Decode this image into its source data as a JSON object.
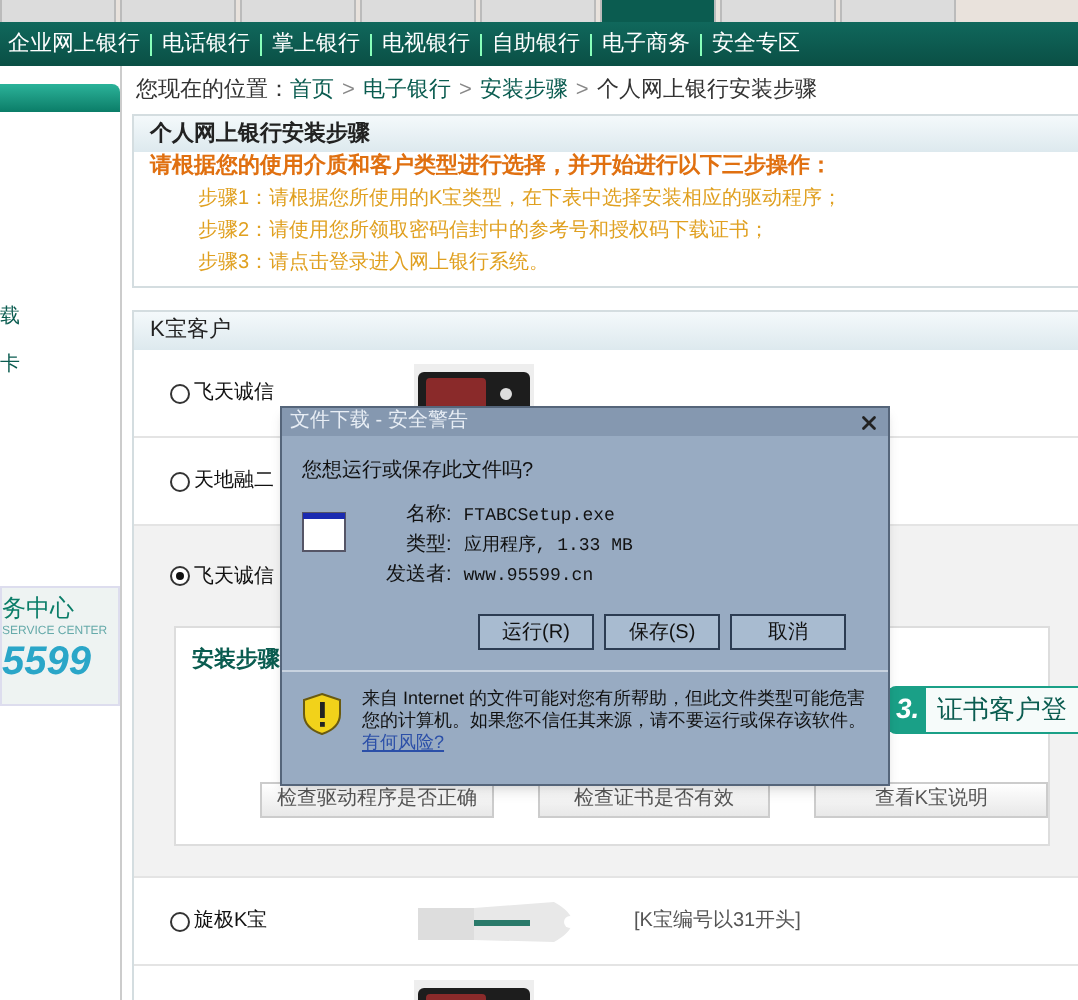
{
  "top_tabs": [
    {
      "selected": false
    },
    {
      "selected": false
    },
    {
      "selected": false
    },
    {
      "selected": false
    },
    {
      "selected": false
    },
    {
      "selected": true
    },
    {
      "selected": false
    },
    {
      "selected": false
    }
  ],
  "sub_nav": [
    "企业网上银行",
    "电话银行",
    "掌上银行",
    "电视银行",
    "自助银行",
    "电子商务",
    "安全专区"
  ],
  "breadcrumb": {
    "prefix": "您现在的位置：",
    "separator": ">",
    "links": [
      "首页",
      "电子银行",
      "安装步骤"
    ],
    "current": "个人网上银行安装步骤"
  },
  "sidebar": {
    "fragments": [
      "载",
      "卡"
    ],
    "service_center": {
      "title": "务中心",
      "subtitle": "SERVICE CENTER",
      "number": "5599"
    }
  },
  "guide": {
    "title": "个人网上银行安装步骤",
    "intro": "请根据您的使用介质和客户类型进行选择，并开始进行以下三步操作：",
    "steps": [
      "步骤1：请根据您所使用的K宝类型，在下表中选择安装相应的驱动程序；",
      "步骤2：请使用您所领取密码信封中的参考号和授权码下载证书；",
      "步骤3：请点击登录进入网上银行系统。"
    ]
  },
  "kbao_panel": {
    "title": "K宝客户",
    "products": [
      {
        "name": "飞天诚信",
        "selected": false,
        "picture": {
          "dark": true
        }
      },
      {
        "name": "天地融二",
        "selected": false
      },
      {
        "name": "飞天诚信",
        "selected": true,
        "install": {
          "label": "安装步骤",
          "step_badge": "3.",
          "step_title": "证书客户登",
          "buttons": [
            "检查驱动程序是否正确",
            "检查证书是否有效",
            "查看K宝说明"
          ]
        }
      },
      {
        "name": "旋极K宝",
        "selected": false,
        "picture": {
          "dark": false
        },
        "note": "[K宝编号以31开头]"
      },
      {
        "picture": {
          "dark": true
        }
      }
    ]
  },
  "dialog": {
    "title": "文件下载 - 安全警告",
    "question": "您想运行或保存此文件吗?",
    "fields": [
      {
        "label": "名称:",
        "value": "FTABCSetup.exe"
      },
      {
        "label": "类型:",
        "value": "应用程序, 1.33 MB"
      },
      {
        "label": "发送者:",
        "value": "www.95599.cn"
      }
    ],
    "buttons": [
      "运行(R)",
      "保存(S)",
      "取消"
    ],
    "warning": "来自 Internet 的文件可能对您有所帮助，但此文件类型可能危害您的计算机。如果您不信任其来源，请不要运行或保存该软件。",
    "risk_link": "有何风险?"
  }
}
